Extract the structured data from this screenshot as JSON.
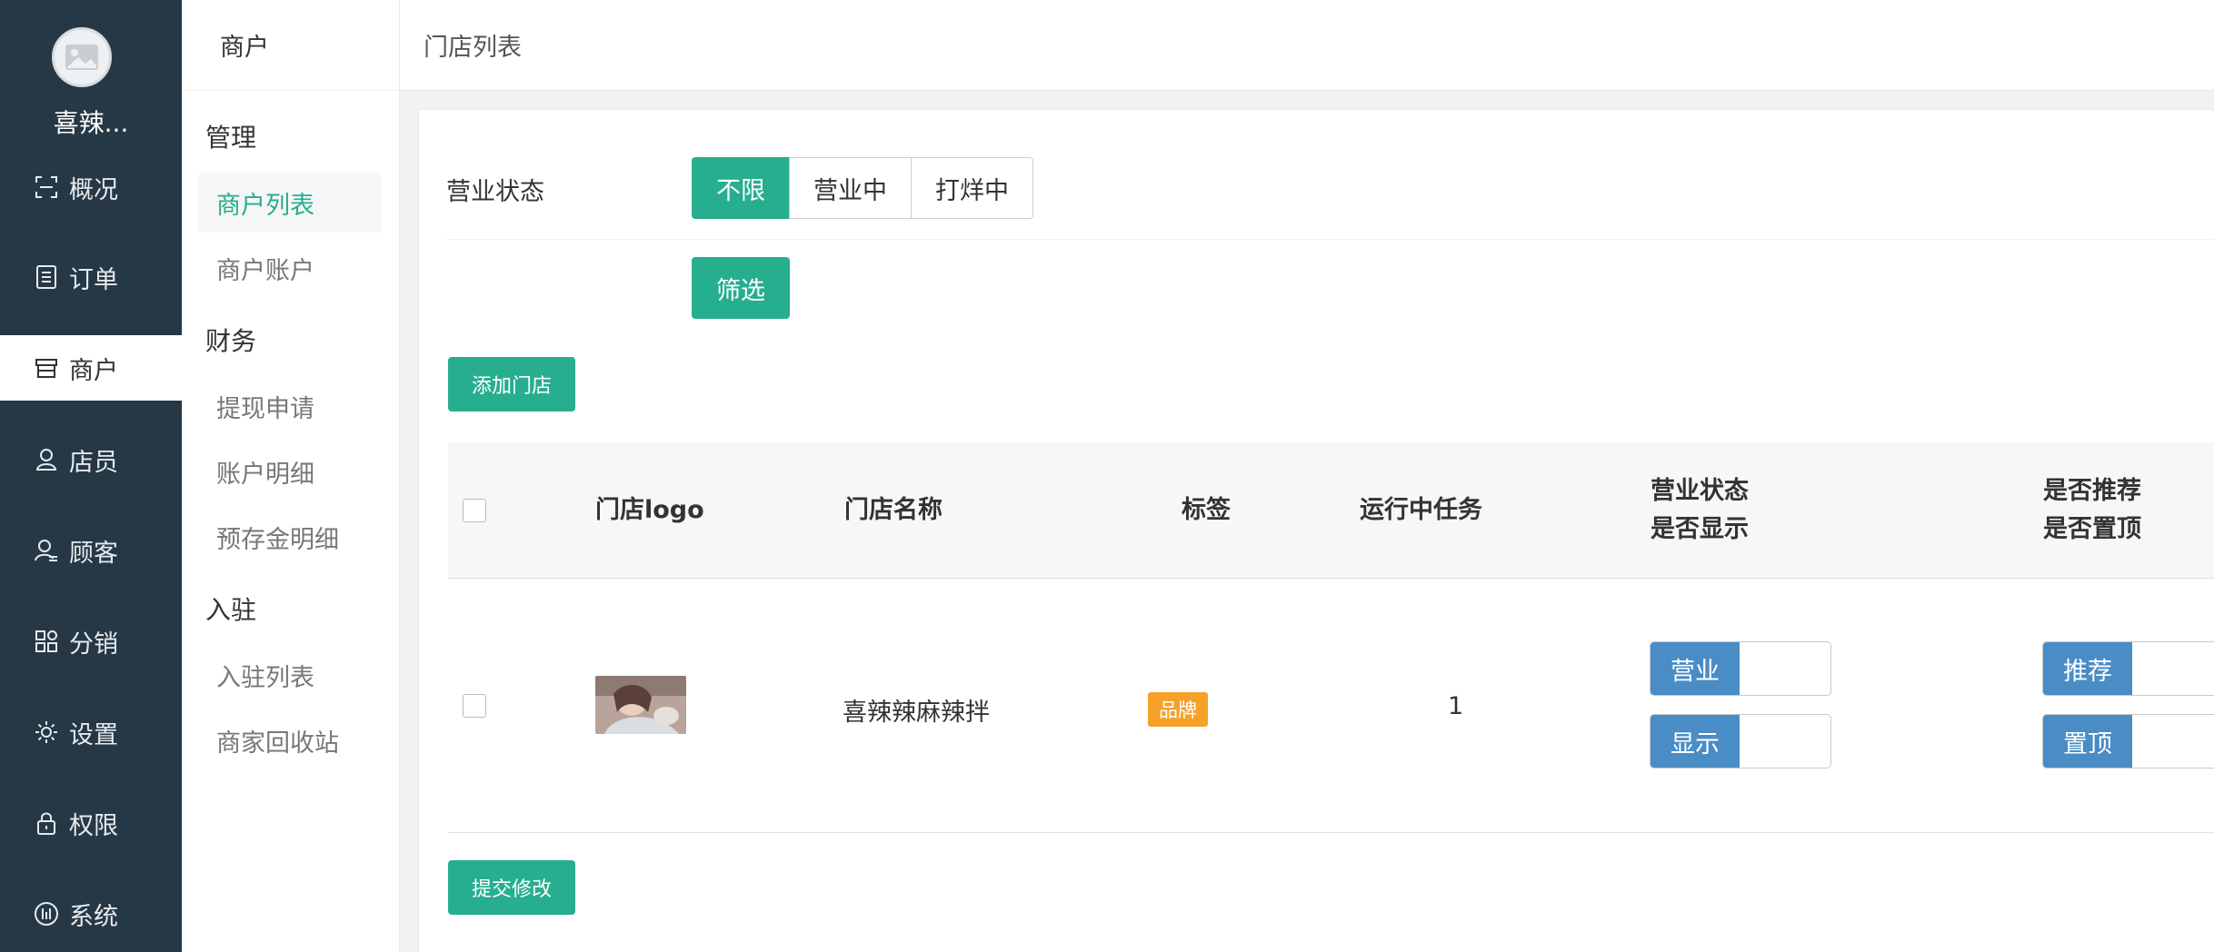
{
  "sidebar": {
    "store_name": "喜辣...",
    "items": [
      {
        "label": "概况",
        "icon": "scan-icon"
      },
      {
        "label": "订单",
        "icon": "list-icon"
      },
      {
        "label": "商户",
        "icon": "store-icon"
      },
      {
        "label": "店员",
        "icon": "person-icon"
      },
      {
        "label": "顾客",
        "icon": "customer-icon"
      },
      {
        "label": "分销",
        "icon": "grid-icon"
      },
      {
        "label": "设置",
        "icon": "gear-icon"
      },
      {
        "label": "权限",
        "icon": "lock-icon"
      },
      {
        "label": "系统",
        "icon": "system-icon"
      }
    ],
    "active_index": 2
  },
  "subnav": {
    "title": "商户",
    "groups": [
      {
        "title": "管理",
        "items": [
          "商户列表",
          "商户账户"
        ]
      },
      {
        "title": "财务",
        "items": [
          "提现申请",
          "账户明细",
          "预存金明细"
        ]
      },
      {
        "title": "入驻",
        "items": [
          "入驻列表",
          "商家回收站"
        ]
      }
    ],
    "active_item": "商户列表"
  },
  "header": {
    "title": "门店列表"
  },
  "filter": {
    "label": "营业状态",
    "options": [
      "不限",
      "营业中",
      "打烊中"
    ],
    "selected": "不限",
    "filter_button": "筛选"
  },
  "actions": {
    "add_store": "添加门店",
    "submit": "提交修改"
  },
  "table": {
    "headers": {
      "logo": "门店logo",
      "name": "门店名称",
      "tag": "标签",
      "tasks": "运行中任务",
      "status_1": "营业状态",
      "status_2": "是否显示",
      "rec_1": "是否推荐",
      "rec_2": "是否置顶"
    },
    "rows": [
      {
        "name": "喜辣辣麻辣拌",
        "tag": "品牌",
        "tasks": "1",
        "toggle_open": "营业",
        "toggle_show": "显示",
        "toggle_recommend": "推荐",
        "toggle_top": "置顶"
      }
    ]
  },
  "colors": {
    "sidebar_bg": "#263845",
    "accent": "#26ae8f",
    "toggle_blue": "#4a8cc6",
    "badge_orange": "#f5a12a"
  }
}
